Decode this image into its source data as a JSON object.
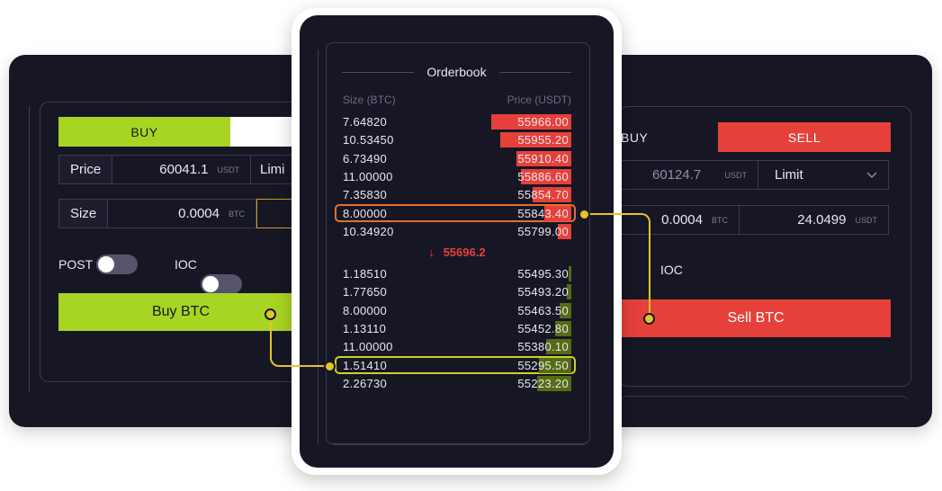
{
  "buy_panel": {
    "tab_buy": "BUY",
    "price_label": "Price",
    "price_value": "60041.1",
    "price_unit": "USDT",
    "order_type": "Limi",
    "size_label": "Size",
    "size_value": "0.0004",
    "size_unit": "BTC",
    "post_label": "POST",
    "ioc_label": "IOC",
    "buy_button": "Buy BTC"
  },
  "sell_panel": {
    "tab_buy": "BUY",
    "tab_sell": "SELL",
    "price_value": "60124.7",
    "price_unit": "USDT",
    "order_type": "Limit",
    "size_value": "0.0004",
    "size_unit": "BTC",
    "total_value": "24.0499",
    "total_unit": "USDT",
    "ioc_label": "IOC",
    "sell_button": "Sell BTC"
  },
  "orderbook": {
    "title": "Orderbook",
    "size_header": "Size (BTC)",
    "price_header": "Price (USDT)",
    "mid_price": "55696.2",
    "mid_arrow": "↓",
    "asks": [
      {
        "size": "7.64820",
        "price": "55966.00",
        "depth": 0.35
      },
      {
        "size": "10.53450",
        "price": "55955.20",
        "depth": 0.31
      },
      {
        "size": "6.73490",
        "price": "55910.40",
        "depth": 0.24
      },
      {
        "size": "11.00000",
        "price": "55886.60",
        "depth": 0.22
      },
      {
        "size": "7.35830",
        "price": "55854.70",
        "depth": 0.17
      },
      {
        "size": "8.00000",
        "price": "55843.40",
        "depth": 0.12
      },
      {
        "size": "10.34920",
        "price": "55799.00",
        "depth": 0.06
      }
    ],
    "bids": [
      {
        "size": "1.18510",
        "price": "55495.30",
        "depth": 0.01
      },
      {
        "size": "1.77650",
        "price": "55493.20",
        "depth": 0.02
      },
      {
        "size": "8.00000",
        "price": "55463.50",
        "depth": 0.05
      },
      {
        "size": "1.13110",
        "price": "55452.80",
        "depth": 0.07
      },
      {
        "size": "11.00000",
        "price": "55380.10",
        "depth": 0.11
      },
      {
        "size": "1.51410",
        "price": "55295.50",
        "depth": 0.14
      },
      {
        "size": "2.26730",
        "price": "55223.20",
        "depth": 0.15
      }
    ]
  },
  "colors": {
    "buy_green": "#a8d424",
    "sell_red": "#e5413a",
    "panel_bg": "#171625",
    "highlight_yellow": "#e2c52a",
    "highlight_orange": "#e0722e"
  }
}
